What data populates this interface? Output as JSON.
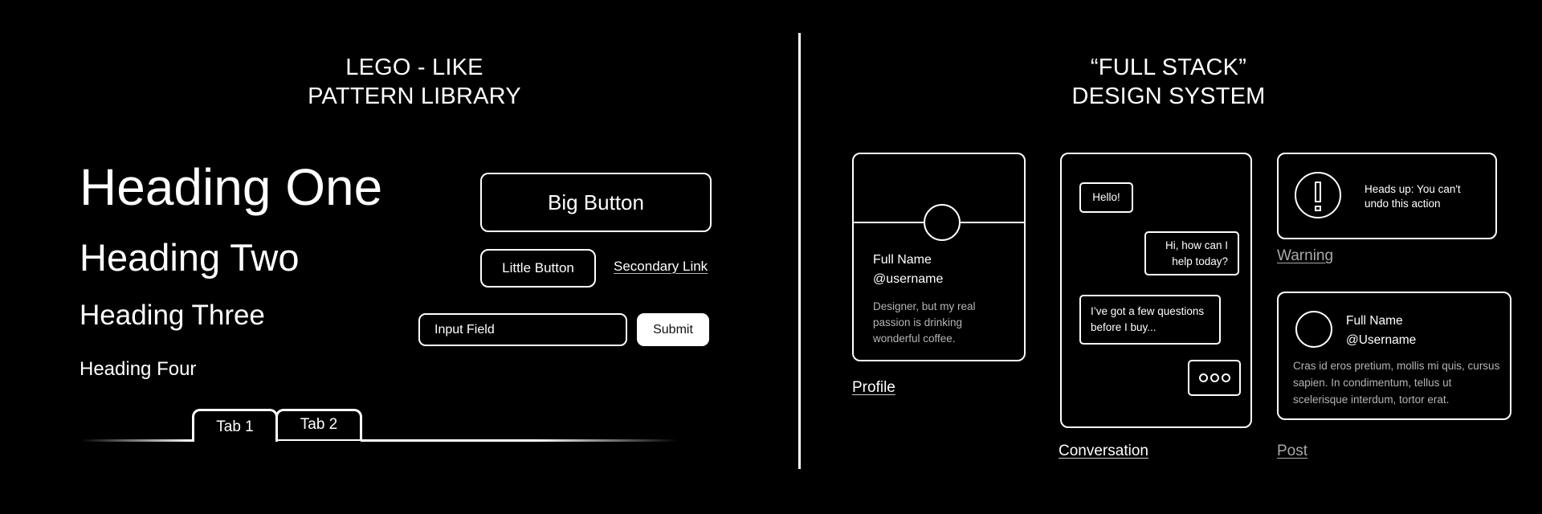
{
  "left_section": {
    "title_line1": "LEGO - LIKE",
    "title_line2": "PATTERN LIBRARY",
    "headings": {
      "h1": "Heading One",
      "h2": "Heading Two",
      "h3": "Heading Three",
      "h4": "Heading Four"
    },
    "big_button": "Big Button",
    "little_button": "Little Button",
    "secondary_link": "Secondary Link",
    "input": {
      "placeholder": "Input Field",
      "value": ""
    },
    "submit_button": "Submit",
    "tabs": [
      {
        "label": "Tab 1",
        "active": true
      },
      {
        "label": "Tab 2",
        "active": false
      }
    ]
  },
  "right_section": {
    "title_line1": "“FULL STACK”",
    "title_line2": "DESIGN SYSTEM",
    "profile": {
      "name": "Full Name",
      "username": "@username",
      "bio": "Designer, but my real passion is drinking wonderful coffee.",
      "label": "Profile"
    },
    "conversation": {
      "messages": [
        {
          "text": "Hello!",
          "side": "left"
        },
        {
          "text": "Hi, how can I help today?",
          "side": "right"
        },
        {
          "text": "I’ve got a few questions before I buy...",
          "side": "left"
        }
      ],
      "typing_icon": "typing-indicator-dots",
      "label": "Conversation"
    },
    "warning": {
      "icon": "exclamation-circle-icon",
      "text": "Heads up: You can't undo this action",
      "label": "Warning"
    },
    "post": {
      "name": "Full Name",
      "username": "@Username",
      "body": "Cras id eros pretium, mollis mi quis, cursus sapien. In condimentum, tellus ut scelerisque interdum, tortor erat.",
      "label": "Post"
    }
  },
  "colors": {
    "background": "#000000",
    "foreground": "#ffffff",
    "muted_text": "#b4b4b4",
    "muted_label": "#a8a8a8"
  }
}
